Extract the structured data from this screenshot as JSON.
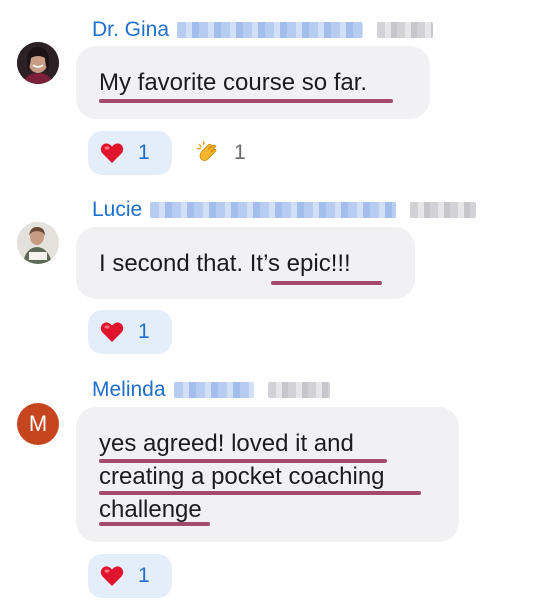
{
  "messages": [
    {
      "author": "Dr. Gina",
      "text": "My favorite course so far.",
      "reactions": [
        {
          "emoji": "heart-emoji",
          "count": "1"
        },
        {
          "emoji": "clapping-hands-emoji",
          "count": "1"
        }
      ]
    },
    {
      "author": "Lucie",
      "text": "I second that. It’s epic!!!",
      "reactions": [
        {
          "emoji": "heart-emoji",
          "count": "1"
        }
      ]
    },
    {
      "author": "Melinda",
      "avatar_letter": "M",
      "text_lines": [
        "yes agreed! loved it and",
        "creating a pocket coaching",
        "challenge"
      ],
      "reactions": [
        {
          "emoji": "heart-emoji",
          "count": "1"
        }
      ]
    }
  ],
  "colors": {
    "author_name": "#1f6fcc",
    "bubble": "#f1f1f4",
    "underline": "#a34a6a",
    "reaction_active": "#e4eefb",
    "avatar_m": "#c5451f"
  }
}
